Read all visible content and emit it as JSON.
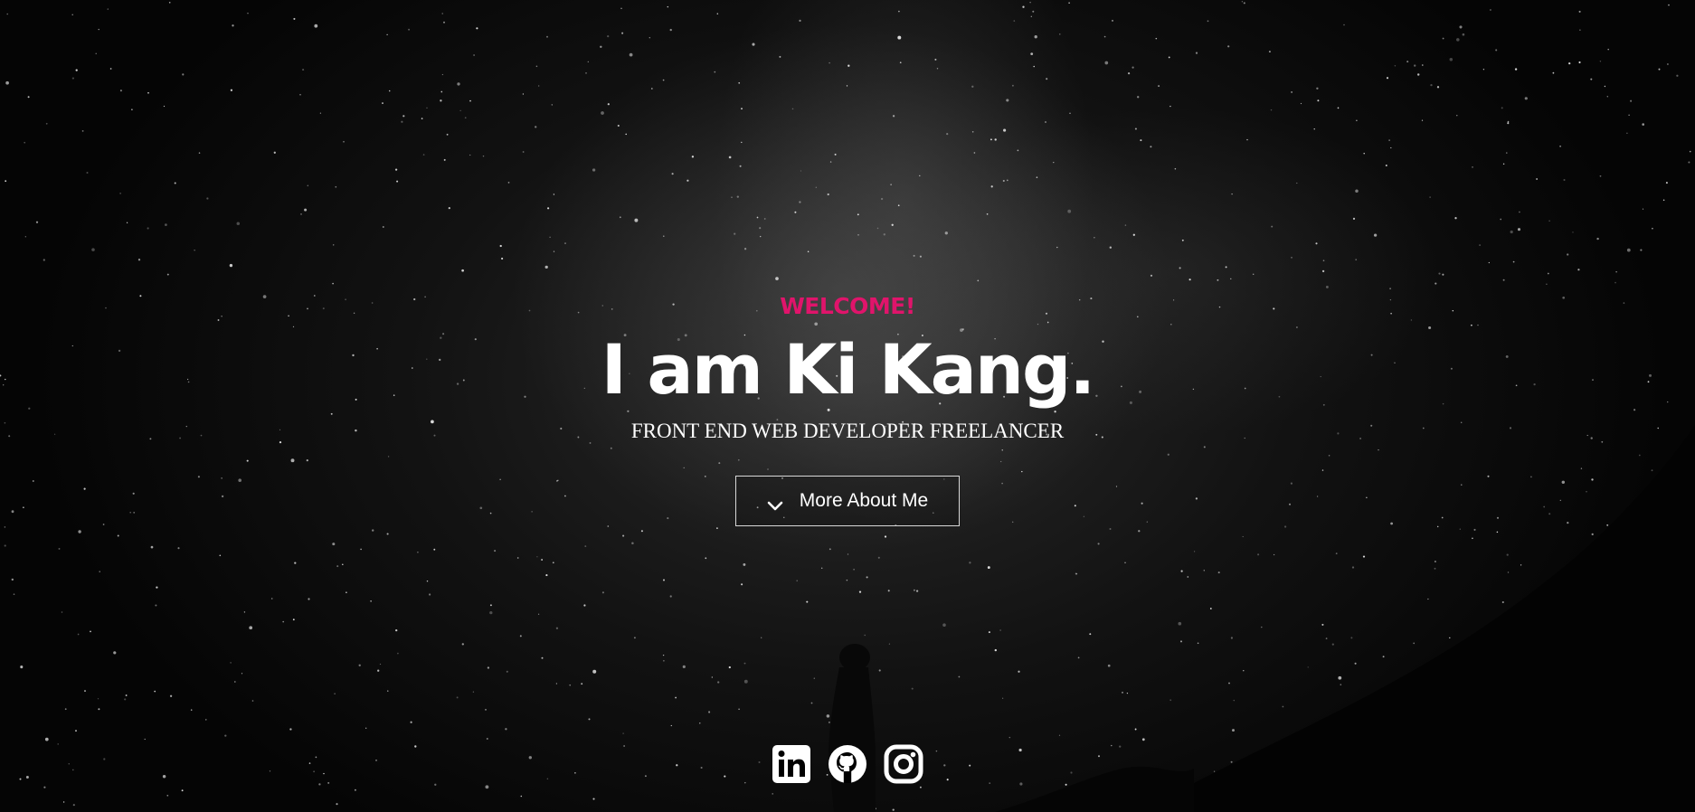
{
  "hero": {
    "welcome": "WELCOME!",
    "title": "I am Ki Kang.",
    "subtitle": "FRONT END WEB DEVELOPER FREELANCER",
    "button_label": "More About Me",
    "button_icon": "chevron-down-icon"
  },
  "social": [
    {
      "icon": "linkedin-icon"
    },
    {
      "icon": "github-icon"
    },
    {
      "icon": "instagram-icon"
    }
  ],
  "colors": {
    "accent": "#e0146b",
    "text": "#ffffff",
    "background": "#000000"
  }
}
